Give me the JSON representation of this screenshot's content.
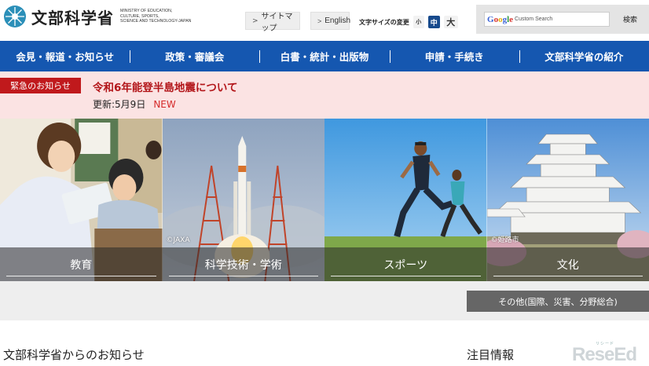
{
  "header": {
    "logo_ja": "文部科学省",
    "logo_en": [
      "MINISTRY OF EDUCATION,",
      "CULTURE, SPORTS,",
      "SCIENCE AND TECHNOLOGY-JAPAN"
    ],
    "sitemap_label": "サイトマップ",
    "english_label": "English",
    "font_size_label": "文字サイズの変更",
    "font_small": "小",
    "font_medium": "中",
    "font_large": "大",
    "search": {
      "placeholder": "Custom Search",
      "google_letters": [
        "G",
        "o",
        "o",
        "g",
        "l",
        "e"
      ],
      "button_label": "検索"
    }
  },
  "nav": {
    "items": [
      {
        "label": "会見・報道・お知らせ"
      },
      {
        "label": "政策・審議会"
      },
      {
        "label": "白書・統計・出版物"
      },
      {
        "label": "申請・手続き"
      },
      {
        "label": "文部科学省の紹介"
      }
    ]
  },
  "alert": {
    "badge": "緊急のお知らせ",
    "title": "令和6年能登半島地震について",
    "update": "更新:5月9日",
    "new_label": "NEW"
  },
  "categories": [
    {
      "label": "教育",
      "credit": ""
    },
    {
      "label": "科学技術・学術",
      "credit": "©JAXA"
    },
    {
      "label": "スポーツ",
      "credit": ""
    },
    {
      "label": "文化",
      "credit": "©姫路市"
    }
  ],
  "other_button": "その他(国際、災害、分野総合)",
  "sections": {
    "notice_heading": "文部科学省からのお知らせ",
    "featured_heading": "注目情報"
  },
  "watermark": {
    "small": "リシード",
    "big": "ReseEd"
  },
  "colors": {
    "nav_blue": "#1557b0",
    "alert_red": "#c0191c",
    "alert_bg": "#fbe3e3",
    "other_gray": "#666666"
  }
}
